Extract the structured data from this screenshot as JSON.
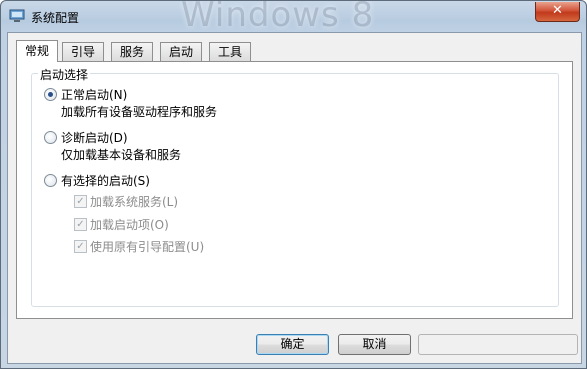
{
  "window": {
    "title": "系统配置",
    "watermark": "Windows 8",
    "close_label": "✕"
  },
  "tabs": [
    {
      "label": "常规",
      "active": true
    },
    {
      "label": "引导",
      "active": false
    },
    {
      "label": "服务",
      "active": false
    },
    {
      "label": "启动",
      "active": false
    },
    {
      "label": "工具",
      "active": false
    }
  ],
  "startup": {
    "group_label": "启动选择",
    "normal": {
      "label": "正常启动(N)",
      "desc": "加载所有设备驱动程序和服务",
      "checked": true
    },
    "diagnostic": {
      "label": "诊断启动(D)",
      "desc": "仅加载基本设备和服务",
      "checked": false
    },
    "selective": {
      "label": "有选择的启动(S)",
      "checked": false,
      "options": [
        {
          "label": "加载系统服务(L)",
          "checked": true
        },
        {
          "label": "加载启动项(O)",
          "checked": true
        },
        {
          "label": "使用原有引导配置(U)",
          "checked": true
        }
      ]
    }
  },
  "buttons": {
    "ok": "确定",
    "cancel": "取消",
    "apply": ""
  },
  "colors": {
    "accent": "#3c7fb1",
    "close": "#c1391b"
  }
}
